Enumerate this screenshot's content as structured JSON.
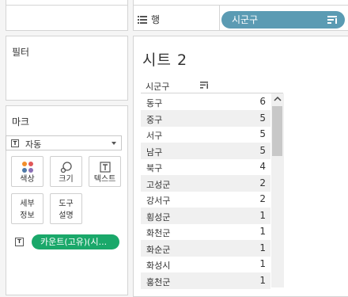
{
  "shelves": {
    "row_label": "행",
    "row_pill": "시군구"
  },
  "filters": {
    "title": "필터"
  },
  "marks": {
    "title": "마크",
    "mark_type": "자동",
    "buttons": {
      "color": "색상",
      "size": "크기",
      "text": "텍스트",
      "detail": "세부\n정보",
      "tooltip": "도구\n설명"
    },
    "text_pill": "카운트(고유)(시..."
  },
  "sheet": {
    "title": "시트 2",
    "column_header": "시군구",
    "rows": [
      {
        "name": "동구",
        "value": "6"
      },
      {
        "name": "중구",
        "value": "5"
      },
      {
        "name": "서구",
        "value": "5"
      },
      {
        "name": "남구",
        "value": "5"
      },
      {
        "name": "북구",
        "value": "4"
      },
      {
        "name": "고성군",
        "value": "2"
      },
      {
        "name": "강서구",
        "value": "2"
      },
      {
        "name": "횡성군",
        "value": "1"
      },
      {
        "name": "화천군",
        "value": "1"
      },
      {
        "name": "화순군",
        "value": "1"
      },
      {
        "name": "화성시",
        "value": "1"
      },
      {
        "name": "홍천군",
        "value": "1"
      }
    ]
  },
  "scrollbar": {
    "position_fraction": 0.07
  },
  "colors": {
    "row_pill": "#5b9bb3",
    "text_pill": "#1aa86a",
    "swatch_orange": "#f28e2b",
    "swatch_red": "#e15759",
    "swatch_blue": "#4e79a7",
    "swatch_purple": "#8b6fb6"
  }
}
